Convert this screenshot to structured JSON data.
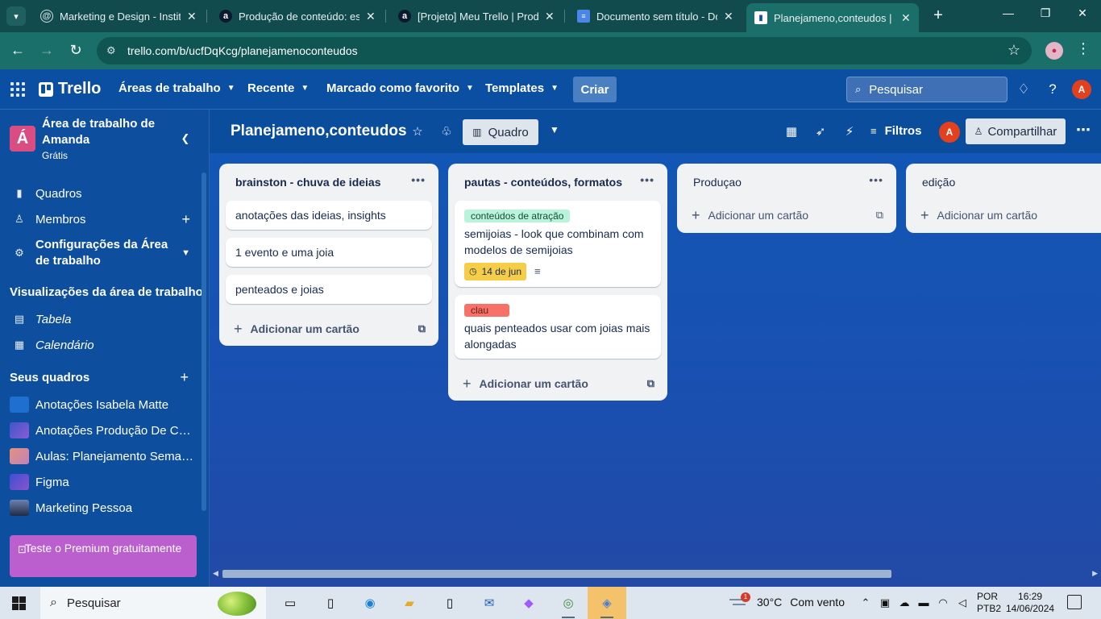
{
  "browser": {
    "tabs": [
      {
        "title": "Marketing e Design - Instituto",
        "icon": "generic-globe-icon"
      },
      {
        "title": "Produção de conteúdo: estratégias",
        "icon": "alura-icon"
      },
      {
        "title": "[Projeto] Meu Trello | Produção",
        "icon": "alura-icon"
      },
      {
        "title": "Documento sem título - Documentos",
        "icon": "google-docs-icon"
      },
      {
        "title": "Planejameno,conteudos | Trello",
        "icon": "trello-icon",
        "active": true
      }
    ],
    "url": "trello.com/b/ucfDqKcg/planejamenoconteudos"
  },
  "header": {
    "logo": "Trello",
    "nav": [
      {
        "label": "Áreas de trabalho"
      },
      {
        "label": "Recente"
      },
      {
        "label": "Marcado como favorito"
      },
      {
        "label": "Templates"
      }
    ],
    "create_label": "Criar",
    "search_placeholder": "Pesquisar",
    "avatar_initial": "A"
  },
  "sidebar": {
    "workspace_initial": "Á",
    "workspace_name": "Área de trabalho de Amanda",
    "plan": "Grátis",
    "items": [
      {
        "label": "Quadros"
      },
      {
        "label": "Membros"
      },
      {
        "label": "Configurações da Área de trabalho"
      }
    ],
    "views_title": "Visualizações da área de trabalho",
    "views": [
      {
        "label": "Tabela"
      },
      {
        "label": "Calendário"
      }
    ],
    "boards_title": "Seus quadros",
    "boards": [
      {
        "label": "Anotações Isabela Matte",
        "color": "#1f6fd0"
      },
      {
        "label": "Anotações Produção De Conteúdo",
        "color": "#6a55c9"
      },
      {
        "label": "Aulas: Planejamento Semanal",
        "color": "#d88aa0"
      },
      {
        "label": "Figma",
        "color": "#6447c9"
      },
      {
        "label": "Marketing Pessoa",
        "color": "#36507e"
      }
    ],
    "premium": "Teste o Premium gratuitamente"
  },
  "board": {
    "title": "Planejameno,conteudos",
    "view_label": "Quadro",
    "filters_label": "Filtros",
    "share_label": "Compartilhar",
    "member_initial": "A",
    "add_card_label": "Adicionar um cartão",
    "lists": [
      {
        "title": "brainston - chuva de ideias",
        "cards": [
          {
            "text": "anotações das ideias, insights"
          },
          {
            "text": "1 evento e uma joia"
          },
          {
            "text": "penteados e joias"
          }
        ]
      },
      {
        "title": "pautas - conteúdos, formatos",
        "cards": [
          {
            "label": "conteúdos de atração",
            "label_color": "#baf3db",
            "label_text_color": "#164b35",
            "text": "semijoias - look que combinam com modelos de semijoias",
            "due": "14 de jun",
            "has_description": true
          },
          {
            "label": "clau",
            "label_color": "#f87168",
            "label_text_color": "#5d1f1a",
            "text": "quais penteados usar com joias mais alongadas"
          }
        ]
      },
      {
        "title": "Produçao",
        "cards": []
      },
      {
        "title": "edição",
        "cards": []
      }
    ]
  },
  "taskbar": {
    "search_placeholder": "Pesquisar",
    "weather_temp": "30°C",
    "weather_cond": "Com vento",
    "weather_badge": "1",
    "lang_line1": "POR",
    "lang_line2": "PTB2",
    "time": "16:29",
    "date": "14/06/2024"
  }
}
